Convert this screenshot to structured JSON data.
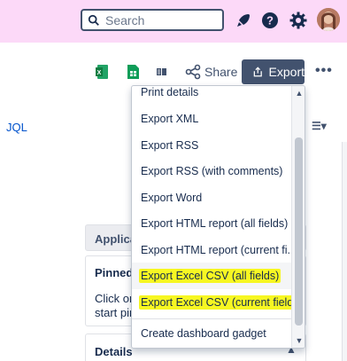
{
  "header": {
    "search_placeholder": "Search"
  },
  "toolbar": {
    "share_label": "Share",
    "export_label": "Export",
    "more_label": "•••"
  },
  "filter": {
    "jql_label": "JQL"
  },
  "export_menu": {
    "items": [
      {
        "label": "Print details"
      },
      {
        "label": "Export XML"
      },
      {
        "label": "Export RSS"
      },
      {
        "label": "Export RSS (with comments)"
      },
      {
        "label": "Export Word"
      },
      {
        "label": "Export HTML report (all fields)"
      },
      {
        "label": "Export HTML report (current fi..."
      },
      {
        "label": "Export Excel CSV (all fields)"
      },
      {
        "label": "Export Excel CSV (current fields)"
      },
      {
        "label": "Create dashboard gadget"
      }
    ]
  },
  "panels": {
    "applications_title": "Applicat",
    "pinned_title": "Pinned f",
    "pinned_body_1": "Click on",
    "pinned_body_2": "start pin",
    "details_title": "Details"
  },
  "colors": {
    "topbar_bg": "#fcd9f8",
    "export_button_bg": "#42526e",
    "highlight": "#f7f722",
    "link": "#0052cc"
  },
  "icons": {
    "search": "search-icon",
    "notifications": "rocket-icon",
    "help": "help-icon",
    "settings": "gear-icon",
    "excel": "excel-icon",
    "sheets": "sheets-icon",
    "share": "share-icon",
    "export": "export-icon"
  }
}
